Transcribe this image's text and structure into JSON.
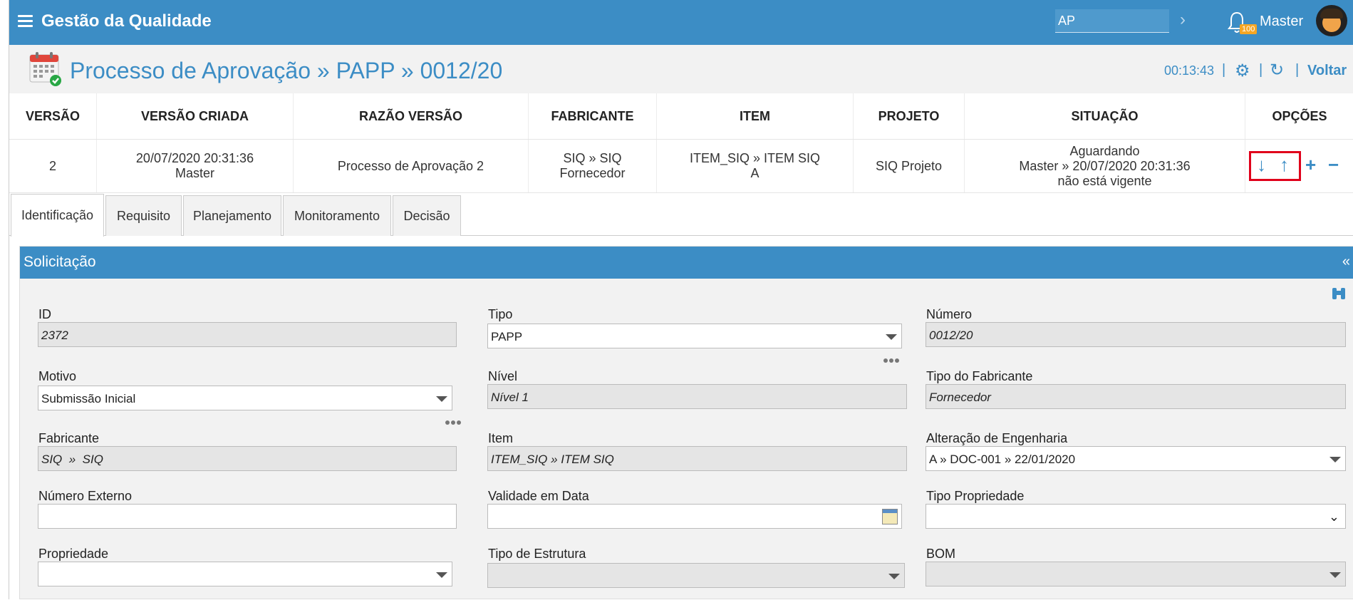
{
  "app": {
    "title": "Gestão da Qualidade"
  },
  "topbar": {
    "search_value": "AP",
    "notification_count": "100",
    "user_name": "Master"
  },
  "header": {
    "title": "Processo de Aprovação » PAPP » 0012/20",
    "timer": "00:13:43",
    "separator": "|",
    "back_label": "Voltar"
  },
  "versions": {
    "columns": [
      "VERSÃO",
      "VERSÃO CRIADA",
      "RAZÃO VERSÃO",
      "FABRICANTE",
      "ITEM",
      "PROJETO",
      "SITUAÇÃO",
      "OPÇÕES"
    ],
    "row": {
      "versao": "2",
      "criada_data": "20/07/2020 20:31:36",
      "criada_user": "Master",
      "razao": "Processo de Aprovação 2",
      "fabricante_1": "SIQ » SIQ",
      "fabricante_2": "Fornecedor",
      "item_1": "ITEM_SIQ » ITEM SIQ",
      "item_2": "A",
      "projeto": "SIQ Projeto",
      "situacao_1": "Aguardando",
      "situacao_2": "Master » 20/07/2020 20:31:36",
      "situacao_3": "não está vigente"
    }
  },
  "tabs": [
    "Identificação",
    "Requisito",
    "Planejamento",
    "Monitoramento",
    "Decisão"
  ],
  "section": {
    "title": "Solicitação",
    "collapse": "«"
  },
  "form": {
    "id": {
      "label": "ID",
      "value": "2372"
    },
    "tipo": {
      "label": "Tipo",
      "value": "PAPP"
    },
    "numero": {
      "label": "Número",
      "value": "0012/20"
    },
    "motivo": {
      "label": "Motivo",
      "value": "Submissão Inicial"
    },
    "nivel": {
      "label": "Nível",
      "value": "Nível 1"
    },
    "tipo_fabricante": {
      "label": "Tipo do Fabricante",
      "value": "Fornecedor"
    },
    "fabricante": {
      "label": "Fabricante",
      "value": "SIQ  »  SIQ"
    },
    "item": {
      "label": "Item",
      "value": "ITEM_SIQ » ITEM SIQ"
    },
    "alteracao": {
      "label": "Alteração de Engenharia",
      "value": "A » DOC-001 » 22/01/2020"
    },
    "numero_externo": {
      "label": "Número Externo",
      "value": ""
    },
    "validade": {
      "label": "Validade em Data",
      "value": ""
    },
    "tipo_propriedade": {
      "label": "Tipo Propriedade",
      "value": ""
    },
    "propriedade": {
      "label": "Propriedade",
      "value": ""
    },
    "tipo_estrutura": {
      "label": "Tipo de Estrutura",
      "value": ""
    },
    "bom": {
      "label": "BOM",
      "value": ""
    }
  }
}
